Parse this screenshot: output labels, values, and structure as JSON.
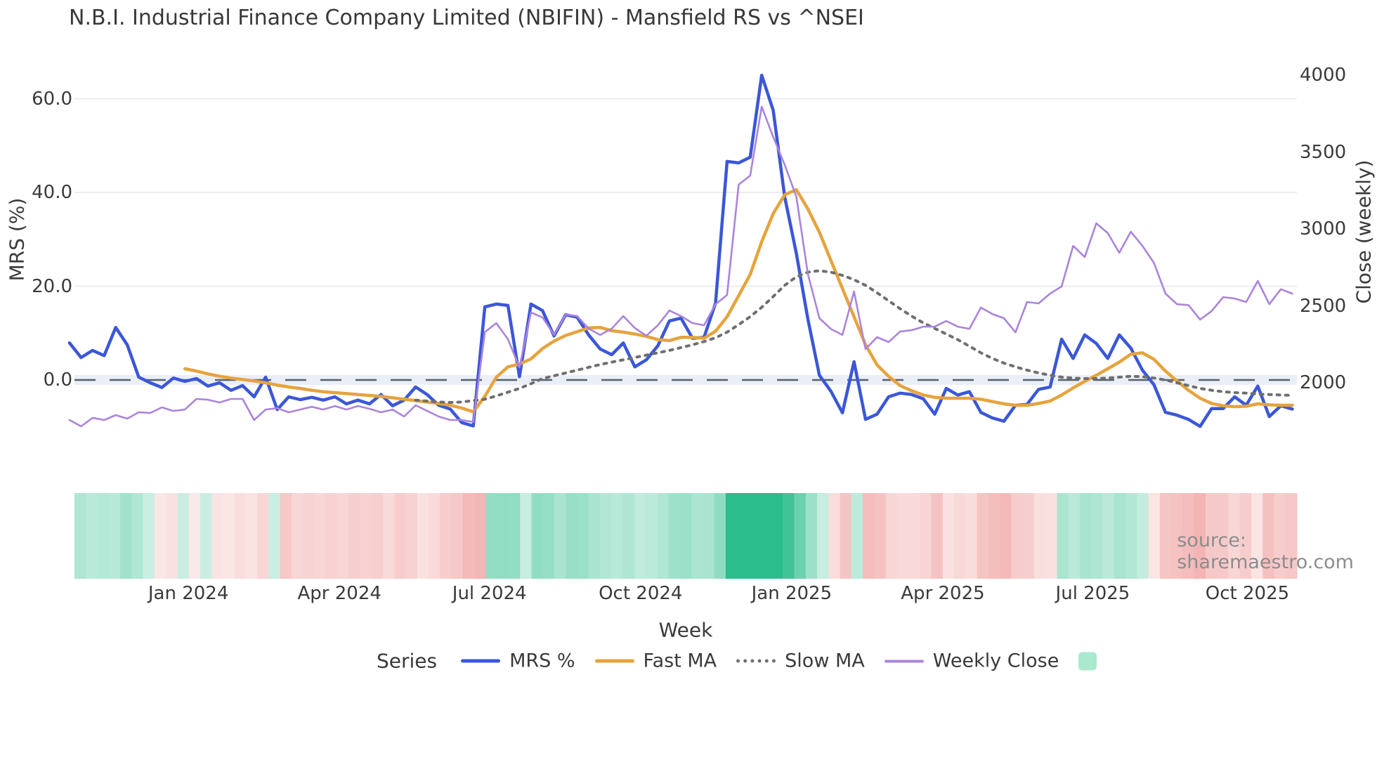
{
  "title": "N.B.I. Industrial Finance Company Limited (NBIFIN) - Mansfield RS vs ^NSEI",
  "source_note": "source: sharemaestro.com",
  "colors": {
    "mrs": "#3b57d8",
    "fast_ma": "#e6a33c",
    "slow_ma": "#6f6f6f",
    "weekly_close": "#ab84dc",
    "grid": "#e9ebf1",
    "zero_band": "#eaeef7",
    "zero_line": "#57606a",
    "strip_positive": "#2bbd8b",
    "strip_negative": "#f1a9a9",
    "legend_patch": "#aae9cf",
    "text": "#3a3a3a",
    "muted_text": "#8d8d8d"
  },
  "x_axis": {
    "label": "Week",
    "tick_labels": [
      "Jan 2024",
      "Apr 2024",
      "Jul 2024",
      "Oct 2024",
      "Jan 2025",
      "Apr 2025",
      "Jul 2025",
      "Oct 2025"
    ]
  },
  "y_left": {
    "label": "MRS (%)",
    "tick_labels": [
      "0.0",
      "20.0",
      "40.0",
      "60.0"
    ]
  },
  "y_right": {
    "label": "Close (weekly)",
    "tick_labels": [
      "2000",
      "2500",
      "3000",
      "3500",
      "4000"
    ]
  },
  "legend": {
    "series_label": "Series",
    "items": [
      {
        "label": "MRS %",
        "style": "line",
        "color": "#3b57d8"
      },
      {
        "label": "Fast MA",
        "style": "line",
        "color": "#e6a33c"
      },
      {
        "label": "Slow MA",
        "style": "dotted",
        "color": "#6f6f6f"
      },
      {
        "label": "Weekly Close",
        "style": "thin-line",
        "color": "#ab84dc"
      },
      {
        "label": "",
        "style": "patch",
        "color": "#aae9cf"
      }
    ]
  },
  "chart_data": {
    "type": "line",
    "frequency": "weekly",
    "points": 107,
    "title": "N.B.I. Industrial Finance Company Limited (NBIFIN) - Mansfield RS vs ^NSEI",
    "xlabel": "Week",
    "ylabel_left": "MRS (%)",
    "ylabel_right": "Close (weekly)",
    "x_tick_labels": [
      "Jan 2024",
      "Apr 2024",
      "Jul 2024",
      "Oct 2024",
      "Jan 2025",
      "Apr 2025",
      "Jul 2025",
      "Oct 2025"
    ],
    "ylim_left": [
      -13,
      67
    ],
    "ylim_right": [
      1700,
      4060
    ],
    "grid": "horizontal-only",
    "legend_position": "bottom",
    "series": [
      {
        "name": "MRS %",
        "axis": "left",
        "values": [
          7.9,
          4.8,
          6.3,
          5.2,
          11.2,
          7.5,
          0.6,
          -0.6,
          -1.6,
          0.4,
          -0.3,
          0.3,
          -1.3,
          -0.6,
          -2.2,
          -1.2,
          -3.6,
          0.6,
          -6.3,
          -3.6,
          -4.2,
          -3.7,
          -4.3,
          -3.6,
          -5.1,
          -4.3,
          -5.1,
          -3.1,
          -5.5,
          -4.3,
          -1.5,
          -3.1,
          -5.4,
          -6.2,
          -9.1,
          -9.8,
          15.6,
          16.2,
          15.9,
          0.7,
          16.2,
          14.8,
          9.4,
          13.9,
          13.4,
          9.6,
          6.6,
          5.4,
          7.9,
          2.8,
          4.3,
          7.3,
          12.6,
          13.2,
          8.9,
          9.1,
          16.4,
          46.6,
          46.3,
          47.5,
          65.0,
          57.5,
          39.0,
          27.0,
          13.0,
          1.0,
          -2.4,
          -7.0,
          3.9,
          -8.4,
          -7.3,
          -3.6,
          -2.8,
          -3.1,
          -4.0,
          -7.3,
          -1.8,
          -3.2,
          -2.5,
          -6.9,
          -8.1,
          -8.8,
          -5.4,
          -5.2,
          -2.0,
          -1.5,
          8.7,
          4.6,
          9.6,
          7.8,
          4.6,
          9.6,
          6.8,
          2.1,
          -1.0,
          -6.9,
          -7.5,
          -8.4,
          -9.9,
          -6.1,
          -6.1,
          -3.6,
          -5.4,
          -1.3,
          -7.8,
          -5.5,
          -6.2
        ]
      },
      {
        "name": "Fast MA",
        "axis": "left",
        "values": [
          null,
          null,
          null,
          null,
          null,
          null,
          null,
          null,
          null,
          null,
          2.4,
          1.9,
          1.3,
          0.8,
          0.4,
          0.1,
          -0.2,
          -0.6,
          -1.1,
          -1.5,
          -1.8,
          -2.2,
          -2.5,
          -2.7,
          -2.9,
          -3.1,
          -3.3,
          -3.5,
          -3.8,
          -4.1,
          -4.4,
          -4.7,
          -5.0,
          -5.4,
          -6.0,
          -6.8,
          -3.5,
          0.6,
          2.8,
          3.4,
          4.5,
          6.7,
          8.3,
          9.5,
          10.3,
          11.1,
          11.2,
          10.5,
          10.2,
          9.8,
          9.3,
          8.6,
          8.4,
          9.1,
          9.1,
          8.9,
          10.4,
          13.5,
          18.0,
          22.5,
          29.5,
          35.5,
          39.5,
          40.6,
          36.5,
          31.5,
          25.5,
          19.5,
          13.5,
          7.5,
          3.2,
          0.8,
          -1.2,
          -2.3,
          -3.2,
          -3.7,
          -3.9,
          -3.9,
          -3.9,
          -4.1,
          -4.6,
          -5.1,
          -5.4,
          -5.4,
          -5.0,
          -4.5,
          -3.2,
          -1.7,
          -0.3,
          1.0,
          2.4,
          3.8,
          5.5,
          5.8,
          4.4,
          1.9,
          -0.2,
          -2.2,
          -3.9,
          -5.0,
          -5.5,
          -5.7,
          -5.6,
          -5.1,
          -5.3,
          -5.4,
          -5.4
        ]
      },
      {
        "name": "Slow MA",
        "axis": "left",
        "values": [
          null,
          null,
          null,
          null,
          null,
          null,
          null,
          null,
          null,
          null,
          null,
          null,
          null,
          null,
          null,
          null,
          null,
          null,
          null,
          null,
          null,
          null,
          null,
          null,
          null,
          null,
          null,
          null,
          null,
          null,
          -4.3,
          -4.5,
          -4.7,
          -4.8,
          -4.7,
          -4.4,
          -4.1,
          -3.4,
          -2.6,
          -1.8,
          -0.8,
          0.3,
          0.9,
          1.5,
          2.1,
          2.7,
          3.3,
          3.8,
          4.3,
          4.8,
          5.3,
          5.8,
          6.3,
          6.9,
          7.5,
          8.2,
          9.0,
          10.2,
          11.8,
          13.5,
          15.5,
          17.8,
          20.2,
          22.0,
          23.0,
          23.3,
          23.0,
          22.3,
          21.4,
          20.2,
          18.6,
          16.9,
          15.2,
          13.6,
          12.2,
          11.0,
          9.8,
          8.6,
          7.2,
          5.8,
          4.6,
          3.6,
          2.8,
          2.1,
          1.5,
          1.0,
          0.6,
          0.4,
          0.3,
          0.3,
          0.4,
          0.6,
          0.8,
          0.7,
          0.4,
          0.0,
          -0.6,
          -1.2,
          -1.8,
          -2.2,
          -2.5,
          -2.7,
          -2.8,
          -3.0,
          -3.1,
          -3.2,
          -3.3
        ]
      },
      {
        "name": "Weekly Close",
        "axis": "right",
        "values": [
          1758,
          1717,
          1772,
          1758,
          1790,
          1767,
          1808,
          1804,
          1840,
          1817,
          1826,
          1895,
          1890,
          1872,
          1895,
          1895,
          1758,
          1826,
          1835,
          1808,
          1826,
          1844,
          1826,
          1849,
          1826,
          1849,
          1831,
          1808,
          1826,
          1781,
          1854,
          1817,
          1781,
          1758,
          1758,
          1745,
          2329,
          2388,
          2283,
          2100,
          2457,
          2425,
          2311,
          2443,
          2434,
          2352,
          2311,
          2352,
          2434,
          2356,
          2306,
          2374,
          2470,
          2434,
          2388,
          2374,
          2511,
          2571,
          3288,
          3347,
          3795,
          3598,
          3416,
          3210,
          2708,
          2420,
          2350,
          2311,
          2594,
          2219,
          2297,
          2265,
          2333,
          2342,
          2365,
          2365,
          2402,
          2365,
          2351,
          2489,
          2447,
          2420,
          2328,
          2525,
          2516,
          2580,
          2626,
          2890,
          2818,
          3037,
          2973,
          2845,
          2982,
          2890,
          2780,
          2580,
          2511,
          2505,
          2411,
          2466,
          2557,
          2548,
          2525,
          2662,
          2511,
          2608,
          2580
        ]
      }
    ],
    "heatmap_strip": {
      "encodes": "sign and intensity of MRS % per week",
      "positive_color": "#2bbd8b",
      "negative_color": "#f1a9a9"
    }
  }
}
